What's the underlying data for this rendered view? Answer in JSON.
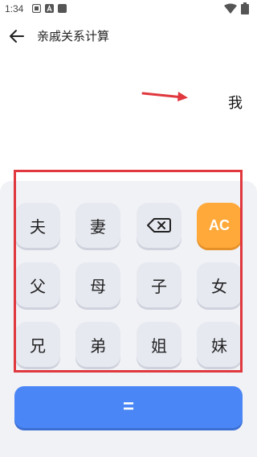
{
  "status_bar": {
    "time": "1:34",
    "icons": [
      "notification-icon",
      "a-icon",
      "app-icon",
      "wifi-icon",
      "battery-icon"
    ]
  },
  "app_bar": {
    "title": "亲戚关系计算",
    "back_icon": "arrow-left-icon"
  },
  "display": {
    "result": "我",
    "annotation_color": "#e0383e"
  },
  "keypad": {
    "keys": [
      "夫",
      "妻",
      "backspace",
      "AC",
      "父",
      "母",
      "子",
      "女",
      "兄",
      "弟",
      "姐",
      "妹"
    ],
    "key_color": "#e7e9f1",
    "ac_color": "#ffa93b"
  },
  "equals_label": "=",
  "colors": {
    "equals": "#4a86f5",
    "highlight": "#e0383e",
    "panel": "#f1f2f6"
  }
}
